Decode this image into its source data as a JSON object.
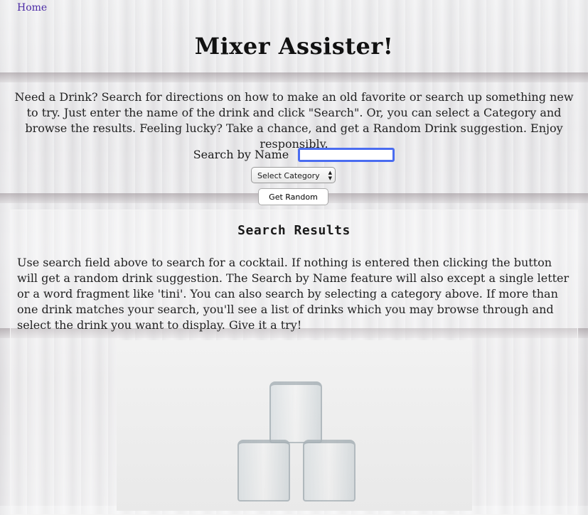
{
  "nav": {
    "home_label": "Home"
  },
  "header": {
    "title": "Mixer Assister!"
  },
  "intro": {
    "text": "Need a Drink? Search for directions on how to make an old favorite or search up something new to try. Just enter the name of the drink and click \"Search\". Or, you can select a Category and browse the results. Feeling lucky? Take a chance, and get a Random Drink suggestion. Enjoy responsibly."
  },
  "search": {
    "label": "Search by Name",
    "value": ""
  },
  "category": {
    "selected": "Select Category"
  },
  "random": {
    "label": "Get Random"
  },
  "results": {
    "title": "Search Results",
    "text": "Use search field above to search for a cocktail. If nothing is entered then clicking the button will get a random drink suggestion. The Search by Name feature will also except a single letter or a word fragment like 'tini'. You can also search by selecting a category above. If more than one drink matches your search, you'll see a list of drinks which you may browse through and select the drink you want to display. Give it a try!"
  },
  "icons": {
    "select_arrows": "select-arrows-icon"
  }
}
